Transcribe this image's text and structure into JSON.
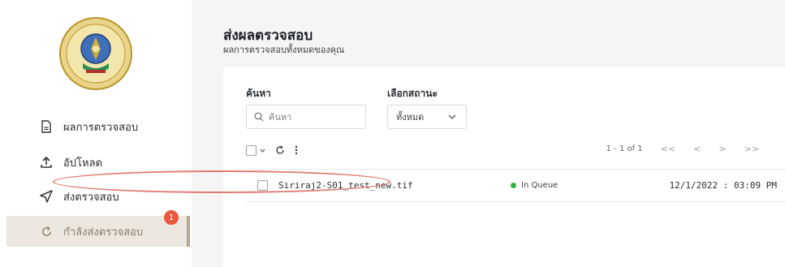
{
  "sidebar": {
    "items": [
      {
        "label": "ผลการตรวจสอบ",
        "icon": "document-icon"
      },
      {
        "label": "อัปโหลด",
        "icon": "upload-icon"
      },
      {
        "label": "ส่งตรวจสอบ",
        "icon": "send-icon"
      },
      {
        "label": "กำลังส่งตรวจสอบ",
        "icon": "refresh-icon",
        "badge": "1"
      }
    ]
  },
  "header": {
    "title": "ส่งผลตรวจสอบ",
    "subtitle": "ผลการตรวจสอบทั้งหมดของคุณ"
  },
  "filters": {
    "search_label": "ค้นหา",
    "search_placeholder": "ค้นหา",
    "status_label": "เลือกสถานะ",
    "status_value": "ทั้งหมด"
  },
  "pagination": {
    "range": "1 - 1 of 1",
    "first": "<<",
    "prev": "<",
    "next": ">",
    "last": ">>"
  },
  "table": {
    "rows": [
      {
        "filename": "Siriraj2-S01_test_new.tif",
        "status": "In Queue",
        "datetime": "12/1/2022 : 03:09 PM"
      }
    ]
  },
  "colors": {
    "accent": "#b9a58c",
    "badge": "#e9573f",
    "status_in_queue": "#2fb344",
    "highlight_oval": "#e07a6e"
  }
}
